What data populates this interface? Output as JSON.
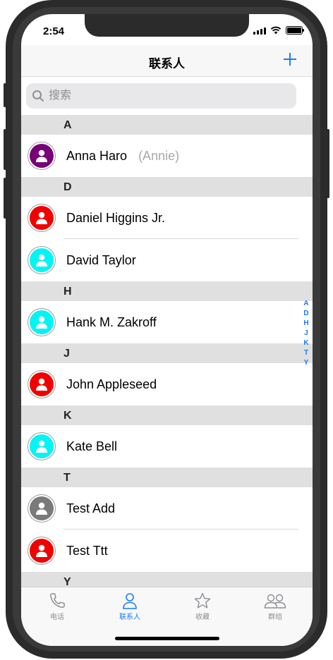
{
  "status": {
    "time": "2:54"
  },
  "nav": {
    "title": "联系人",
    "add_icon": "plus-icon"
  },
  "search": {
    "placeholder": "搜索"
  },
  "sections": [
    {
      "letter": "A",
      "contacts": [
        {
          "name": "Anna Haro",
          "nickname": "(Annie)",
          "avatar_color": "#770077"
        }
      ]
    },
    {
      "letter": "D",
      "contacts": [
        {
          "name": "Daniel Higgins Jr.",
          "nickname": "",
          "avatar_color": "#f20000"
        },
        {
          "name": "David Taylor",
          "nickname": "",
          "avatar_color": "#00f5f5"
        }
      ]
    },
    {
      "letter": "H",
      "contacts": [
        {
          "name": "Hank M. Zakroff",
          "nickname": "",
          "avatar_color": "#00f5f5"
        }
      ]
    },
    {
      "letter": "J",
      "contacts": [
        {
          "name": "John Appleseed",
          "nickname": "",
          "avatar_color": "#f20000"
        }
      ]
    },
    {
      "letter": "K",
      "contacts": [
        {
          "name": "Kate Bell",
          "nickname": "",
          "avatar_color": "#00f5f5"
        }
      ]
    },
    {
      "letter": "T",
      "contacts": [
        {
          "name": "Test Add",
          "nickname": "",
          "avatar_color": "#7a7a7a"
        },
        {
          "name": "Test Ttt",
          "nickname": "",
          "avatar_color": "#f20000"
        }
      ]
    },
    {
      "letter": "Y",
      "contacts": []
    }
  ],
  "index_letters": [
    "A",
    "D",
    "H",
    "J",
    "K",
    "T",
    "Y"
  ],
  "tabs": [
    {
      "label": "电话",
      "icon": "phone-icon",
      "active": false
    },
    {
      "label": "联系人",
      "icon": "person-icon",
      "active": true
    },
    {
      "label": "收藏",
      "icon": "star-icon",
      "active": false
    },
    {
      "label": "群组",
      "icon": "group-icon",
      "active": false
    }
  ],
  "colors": {
    "accent": "#1a7cf5",
    "section_bg": "#e0e0e0"
  }
}
